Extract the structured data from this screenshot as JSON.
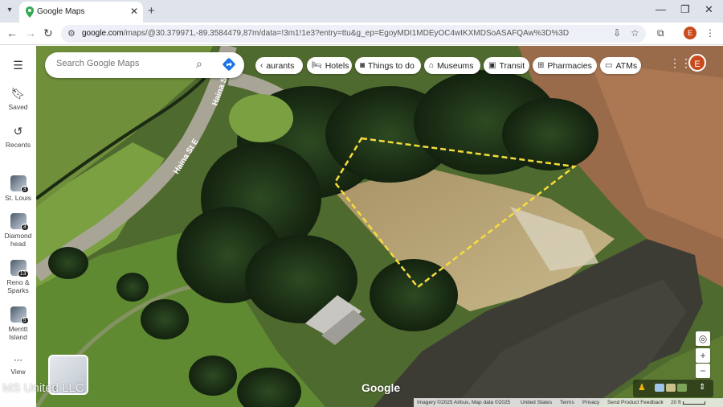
{
  "browser": {
    "tab_title": "Google Maps",
    "url_domain": "google.com",
    "url_path": "/maps/@30.379971,-89.3584479,87m/data=!3m1!1e3?entry=ttu&g_ep=EgoyMDI1MDEyOC4wIKXMDSoASAFQAw%3D%3D",
    "profile_initial": "E"
  },
  "rail": {
    "saved": "Saved",
    "recents": "Recents",
    "view": "View",
    "recent_items": [
      {
        "label": "St. Louis",
        "count": "3"
      },
      {
        "label": "Diamond head",
        "count": "3"
      },
      {
        "label": "Reno & Sparks",
        "count": "13"
      },
      {
        "label": "Merritt Island",
        "count": "5"
      }
    ]
  },
  "search": {
    "placeholder": "Search Google Maps"
  },
  "chips": [
    {
      "label": "aurants",
      "icon": "chevron-left-icon"
    },
    {
      "label": "Hotels",
      "icon": "bed-icon"
    },
    {
      "label": "Things to do",
      "icon": "camera-icon"
    },
    {
      "label": "Museums",
      "icon": "museum-icon"
    },
    {
      "label": "Transit",
      "icon": "train-icon"
    },
    {
      "label": "Pharmacies",
      "icon": "pharmacy-icon"
    },
    {
      "label": "ATMs",
      "icon": "atm-icon"
    }
  ],
  "account_initial": "E",
  "map": {
    "road_labels": [
      "Haina St E",
      "Haina St E"
    ],
    "watermark": "MS United LLC",
    "google_logo": "Google",
    "imagery_credit": "Imagery ©2025 Airbus, Map data ©2025",
    "country": "United States",
    "terms": "Terms",
    "privacy": "Privacy",
    "feedback": "Send Product Feedback",
    "scale": "20 ft",
    "boundary_color": "#f5dd3b"
  }
}
